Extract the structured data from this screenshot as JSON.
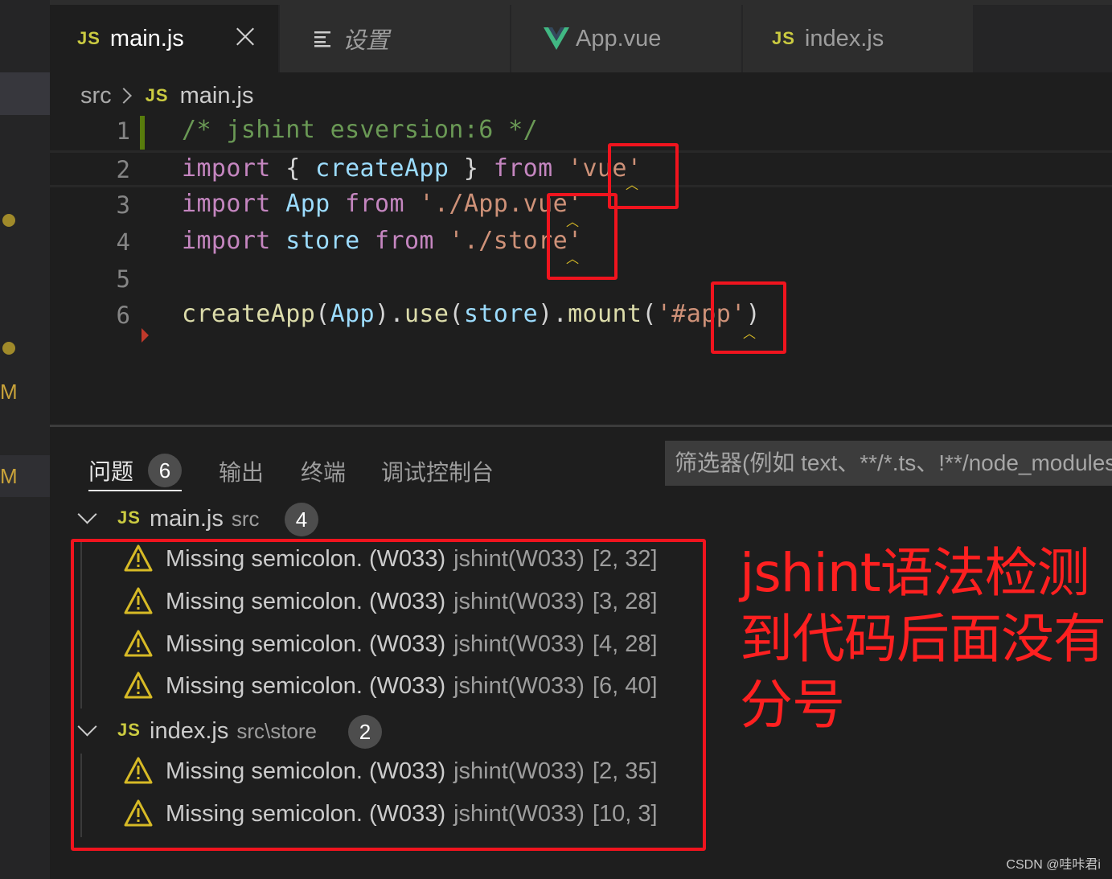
{
  "tabs": [
    {
      "icon": "JS",
      "label": "main.js",
      "active": true
    },
    {
      "icon": "menu",
      "label": "设置",
      "active": false
    },
    {
      "icon": "V",
      "label": "App.vue",
      "active": false
    },
    {
      "icon": "JS",
      "label": "index.js",
      "active": false
    }
  ],
  "breadcrumb": {
    "folder": "src",
    "icon": "JS",
    "file": "main.js"
  },
  "editor": {
    "line_numbers": [
      "1",
      "2",
      "3",
      "4",
      "5",
      "6"
    ],
    "lines": [
      [
        {
          "t": "/* jshint esversion:6 */",
          "c": "c"
        }
      ],
      [
        {
          "t": "import",
          "c": "k"
        },
        {
          "t": " { ",
          "c": "p"
        },
        {
          "t": "createApp",
          "c": "v"
        },
        {
          "t": " } ",
          "c": "p"
        },
        {
          "t": "from",
          "c": "k"
        },
        {
          "t": " ",
          "c": "p"
        },
        {
          "t": "'vue'",
          "c": "s"
        }
      ],
      [
        {
          "t": "import",
          "c": "k"
        },
        {
          "t": " ",
          "c": "p"
        },
        {
          "t": "App",
          "c": "v"
        },
        {
          "t": " ",
          "c": "p"
        },
        {
          "t": "from",
          "c": "k"
        },
        {
          "t": " ",
          "c": "p"
        },
        {
          "t": "'./App.vue'",
          "c": "s"
        }
      ],
      [
        {
          "t": "import",
          "c": "k"
        },
        {
          "t": " ",
          "c": "p"
        },
        {
          "t": "store",
          "c": "v"
        },
        {
          "t": " ",
          "c": "p"
        },
        {
          "t": "from",
          "c": "k"
        },
        {
          "t": " ",
          "c": "p"
        },
        {
          "t": "'./store'",
          "c": "s"
        }
      ],
      [],
      [
        {
          "t": "createApp",
          "c": "f"
        },
        {
          "t": "(",
          "c": "p"
        },
        {
          "t": "App",
          "c": "v"
        },
        {
          "t": ").",
          "c": "p"
        },
        {
          "t": "use",
          "c": "f"
        },
        {
          "t": "(",
          "c": "p"
        },
        {
          "t": "store",
          "c": "v"
        },
        {
          "t": ").",
          "c": "p"
        },
        {
          "t": "mount",
          "c": "f"
        },
        {
          "t": "(",
          "c": "p"
        },
        {
          "t": "'#app'",
          "c": "s"
        },
        {
          "t": ")",
          "c": "p"
        }
      ]
    ]
  },
  "panel": {
    "tabs": [
      {
        "label": "问题",
        "count": "6",
        "active": true
      },
      {
        "label": "输出",
        "active": false
      },
      {
        "label": "终端",
        "active": false
      },
      {
        "label": "调试控制台",
        "active": false
      }
    ],
    "filter_placeholder": "筛选器(例如 text、**/*.ts、!**/node_modules/**)"
  },
  "problems": {
    "groups": [
      {
        "icon": "JS",
        "file": "main.js",
        "path": "src",
        "count": "4",
        "items": [
          {
            "message": "Missing semicolon. (W033)",
            "source": "jshint(W033)",
            "position": "[2, 32]"
          },
          {
            "message": "Missing semicolon. (W033)",
            "source": "jshint(W033)",
            "position": "[3, 28]"
          },
          {
            "message": "Missing semicolon. (W033)",
            "source": "jshint(W033)",
            "position": "[4, 28]"
          },
          {
            "message": "Missing semicolon. (W033)",
            "source": "jshint(W033)",
            "position": "[6, 40]"
          }
        ]
      },
      {
        "icon": "JS",
        "file": "index.js",
        "path": "src\\store",
        "count": "2",
        "items": [
          {
            "message": "Missing semicolon. (W033)",
            "source": "jshint(W033)",
            "position": "[2, 35]"
          },
          {
            "message": "Missing semicolon. (W033)",
            "source": "jshint(W033)",
            "position": "[10, 3]"
          }
        ]
      }
    ]
  },
  "side_badges": [
    "M",
    "M"
  ],
  "annotation": {
    "lines": [
      "jshint语法检测",
      "到代码后面没有",
      "分号"
    ]
  },
  "watermark": "CSDN @哇咔君i",
  "colors": {
    "keyword": "#c586c0",
    "variable": "#9cdcfe",
    "function": "#dcdcaa",
    "string": "#ce9178",
    "comment": "#6a9955",
    "warning": "#d7ba26",
    "annotation_red": "#ff2020"
  }
}
